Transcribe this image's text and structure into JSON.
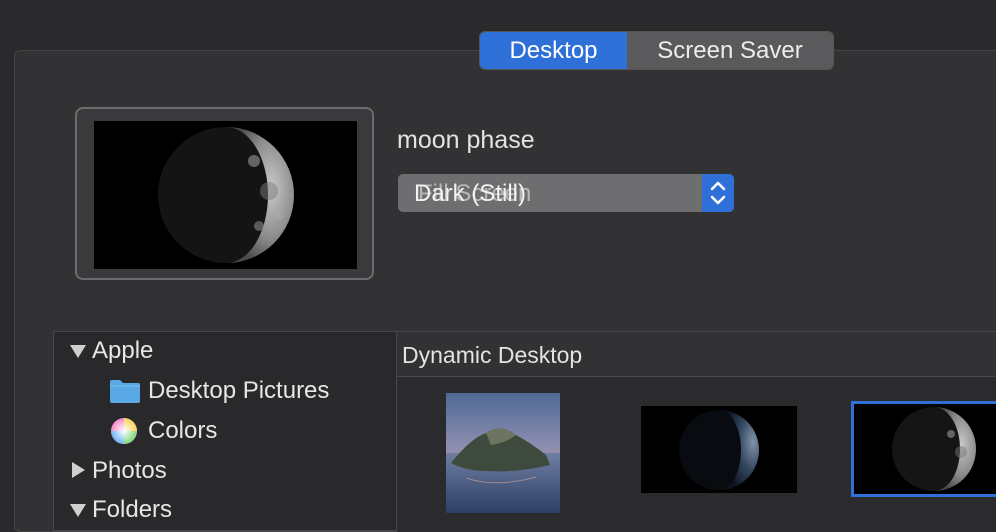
{
  "tabs": {
    "desktop": "Desktop",
    "screen_saver": "Screen Saver"
  },
  "wallpaper": {
    "name": "moon phase"
  },
  "mode_select": {
    "value": "Dark (Still)",
    "overlapping_value": "Fill Screen"
  },
  "sidebar": {
    "apple": "Apple",
    "desktop_pictures": "Desktop Pictures",
    "colors": "Colors",
    "photos": "Photos",
    "folders": "Folders"
  },
  "gallery": {
    "title": "Dynamic Desktop"
  },
  "colors": {
    "accent": "#2f6fd8",
    "folder": "#5aa9e6"
  }
}
